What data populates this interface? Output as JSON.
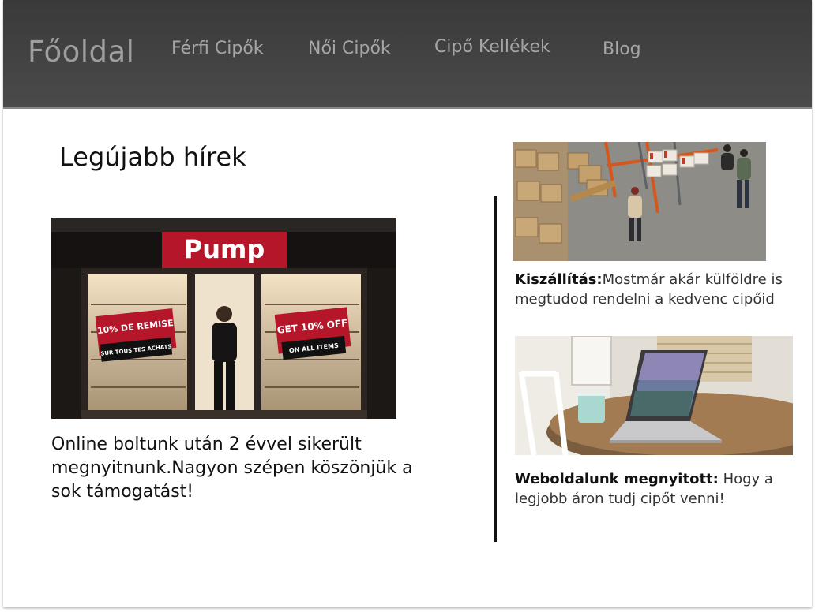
{
  "nav": {
    "home": "Főoldal",
    "items": [
      {
        "label": "Férfi Cipők"
      },
      {
        "label": "Női Cipők"
      },
      {
        "label": "Cipő Kellékek"
      },
      {
        "label": "Blog"
      }
    ]
  },
  "main": {
    "heading": "Legújabb hírek",
    "article": {
      "text": "Online boltunk után 2 évvel sikerült megnyitnunk.Nagyon szépen köszönjük a sok támogatást!",
      "image": {
        "store_sign": "Pump",
        "poster_left_top": "10% DE REMISE",
        "poster_left_bottom": "SUR TOUS TES ACHATS",
        "poster_right_top": "GET 10% OFF",
        "poster_right_bottom": "ON ALL ITEMS"
      }
    }
  },
  "sidebar": {
    "items": [
      {
        "title": "Kiszállítás:",
        "text": "Mostmár akár külföldre is megtudod rendelni a kedvenc cipőid"
      },
      {
        "title": "Weboldalunk megnyitott:",
        "text": " Hogy a legjobb áron  tudj cipőt venni!"
      }
    ]
  },
  "colors": {
    "navbar": "#404040",
    "nav_text": "#a6a6a6",
    "sign_red": "#b5162a"
  }
}
